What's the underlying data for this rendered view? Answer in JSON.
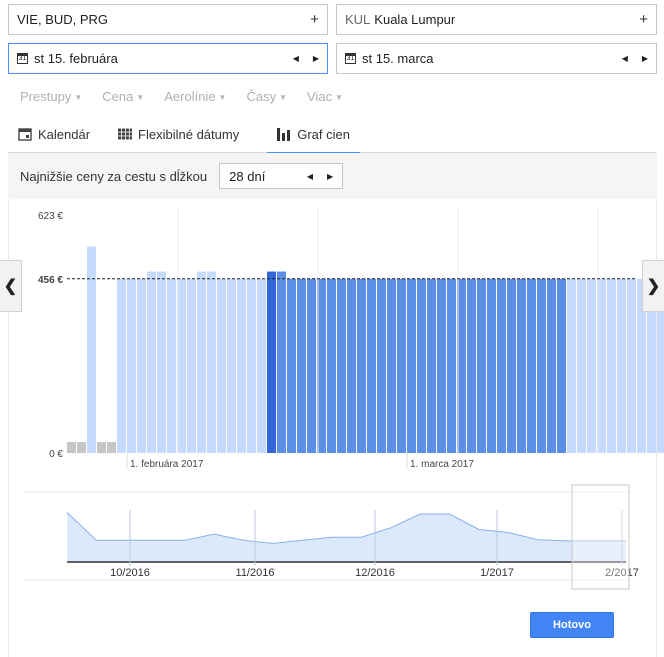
{
  "origin": {
    "value": "VIE, BUD, PRG",
    "add_symbol": "+"
  },
  "destination": {
    "code": "KUL",
    "name": "Kuala Lumpur",
    "add_symbol": "+"
  },
  "depart_date": {
    "icon_text": "31",
    "value": "st 15. februára"
  },
  "return_date": {
    "icon_text": "31",
    "value": "st 15. marca"
  },
  "filters": [
    {
      "label": "Prestupy"
    },
    {
      "label": "Cena"
    },
    {
      "label": "Aerolínie"
    },
    {
      "label": "Časy"
    },
    {
      "label": "Viac"
    }
  ],
  "tabs": [
    {
      "label": "Kalendár",
      "icon": "calendar-icon"
    },
    {
      "label": "Flexibilné dátumy",
      "icon": "grid-icon"
    },
    {
      "label": "Graf cien",
      "icon": "bar-chart-icon",
      "selected": true
    }
  ],
  "duration": {
    "label": "Najnižšie ceny za cestu s dĺžkou",
    "value": "28 dní"
  },
  "done_button": "Hotovo",
  "colors": {
    "bar_light": "#c6dafc",
    "bar_selected": "#5b8ee5",
    "bar_selected_start": "#3367d6",
    "bar_empty": "#c6c6c6",
    "overview_fill": "#dce9fb",
    "overview_line": "#8ab0ea",
    "accent": "#4285f4"
  },
  "chart_data": [
    {
      "type": "bar",
      "y_tick_labels": [
        "623 €",
        "456 €",
        "0 €"
      ],
      "y_ticks": [
        623,
        456,
        0
      ],
      "reference_line": 456,
      "x_tick_labels": [
        "1. februára 2017",
        "1. marca 2017"
      ],
      "ylim": [
        0,
        623
      ],
      "values": [
        0,
        0,
        540,
        0,
        0,
        456,
        456,
        456,
        475,
        475,
        456,
        456,
        456,
        475,
        475,
        456,
        456,
        456,
        456,
        456,
        475,
        475,
        456,
        456,
        456,
        456,
        456,
        456,
        456,
        456,
        456,
        456,
        456,
        456,
        456,
        456,
        456,
        456,
        456,
        456,
        456,
        456,
        456,
        456,
        456,
        456,
        456,
        456,
        456,
        456,
        456,
        456,
        456,
        456,
        456,
        456,
        456,
        456,
        456,
        456,
        456,
        456,
        456,
        456,
        456,
        456,
        456,
        456,
        456,
        456,
        456
      ],
      "bar_states": []
    },
    {
      "type": "area",
      "x_tick_labels": [
        "10/2016",
        "11/2016",
        "12/2016",
        "1/2017",
        "2/2017"
      ],
      "values": [
        560,
        470,
        470,
        470,
        470,
        490,
        470,
        460,
        470,
        480,
        480,
        510,
        555,
        555,
        505,
        495,
        472,
        468,
        468,
        468
      ]
    }
  ]
}
